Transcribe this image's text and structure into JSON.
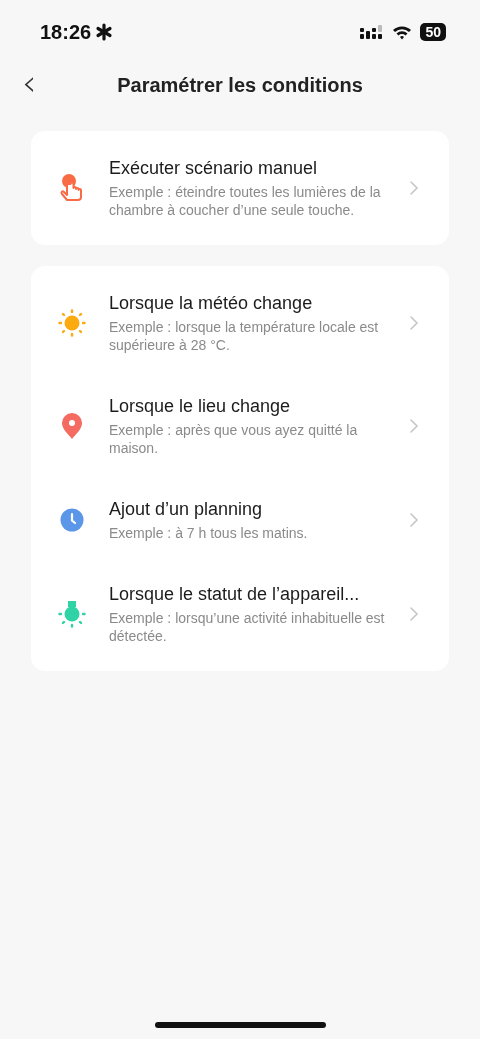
{
  "status_bar": {
    "time": "18:26",
    "battery": "50"
  },
  "header": {
    "back": "‹",
    "title": "Paramétrer les conditions"
  },
  "groups": [
    {
      "items": [
        {
          "kind": "tap",
          "title": "Exécuter scénario manuel",
          "description": "Exemple : éteindre toutes les lumières de la chambre à coucher d’une seule touche."
        }
      ]
    },
    {
      "items": [
        {
          "kind": "weather",
          "title": "Lorsque la météo change",
          "description": "Exemple : lorsque la température locale est supérieure à 28 °C."
        },
        {
          "kind": "location",
          "title": "Lorsque le lieu change",
          "description": "Exemple : après que vous ayez quitté la maison."
        },
        {
          "kind": "schedule",
          "title": "Ajout d’un planning",
          "description": "Exemple : à 7 h tous les matins."
        },
        {
          "kind": "device",
          "title": "Lorsque le statut de l’appareil...",
          "description": "Exemple : lorsqu’une activité inhabituelle est détectée."
        }
      ]
    }
  ]
}
